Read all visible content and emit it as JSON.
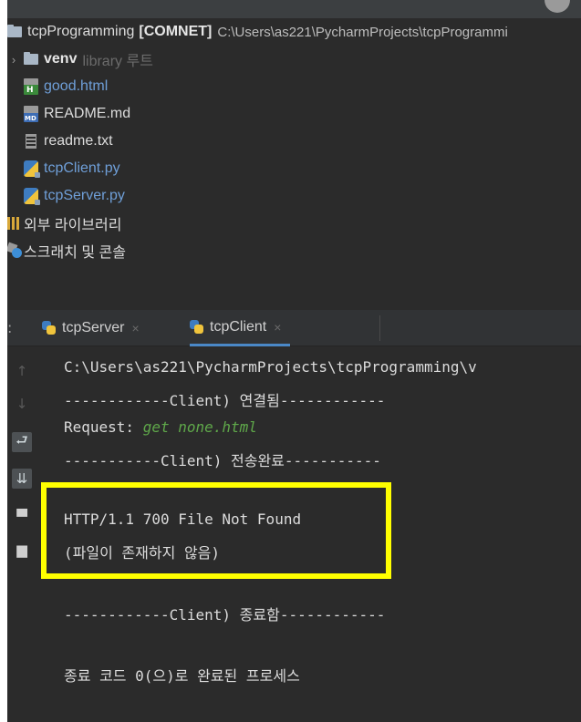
{
  "project": {
    "root_name": "tcpProgramming",
    "root_module": "[COMNET]",
    "root_path": "C:\\Users\\as221\\PycharmProjects\\tcpProgrammi",
    "items": [
      {
        "label": "venv",
        "suffix": "library 루트",
        "icon": "folder-icon"
      },
      {
        "label": "good.html",
        "icon": "html-file-icon"
      },
      {
        "label": "README.md",
        "icon": "markdown-file-icon"
      },
      {
        "label": "readme.txt",
        "icon": "text-file-icon"
      },
      {
        "label": "tcpClient.py",
        "icon": "python-file-icon"
      },
      {
        "label": "tcpServer.py",
        "icon": "python-file-icon"
      },
      {
        "label": "외부 라이브러리",
        "icon": "library-icon"
      },
      {
        "label": "스크래치 및 콘솔",
        "icon": "scratch-icon"
      }
    ]
  },
  "run_tabs": {
    "prefix": ":",
    "tabs": [
      {
        "label": "tcpServer",
        "close": "×",
        "active": false
      },
      {
        "label": "tcpClient",
        "close": "×",
        "active": true
      }
    ]
  },
  "console": {
    "gutter_icons": [
      "arrow-up-icon",
      "arrow-down-icon",
      "soft-wrap-icon",
      "scroll-to-end-icon",
      "print-icon",
      "trash-icon"
    ],
    "lines": {
      "l0": "C:\\Users\\as221\\PycharmProjects\\tcpProgramming\\v",
      "l1": "------------Client) 연결됨------------",
      "l2_label": "Request: ",
      "l2_value": "get none.html",
      "l3": "-----------Client) 전송완료-----------",
      "l4": "HTTP/1.1 700 File Not Found",
      "l5": "(파일이 존재하지 않음)",
      "l6": "------------Client) 종료함------------",
      "l7": "종료 코드 0(으)로 완료된 프로세스"
    }
  },
  "colors": {
    "highlight_border": "#ffff00",
    "active_tab_underline": "#4a88c7",
    "request_value": "#5fa84a",
    "file_name_blue": "#6f9fd8"
  }
}
